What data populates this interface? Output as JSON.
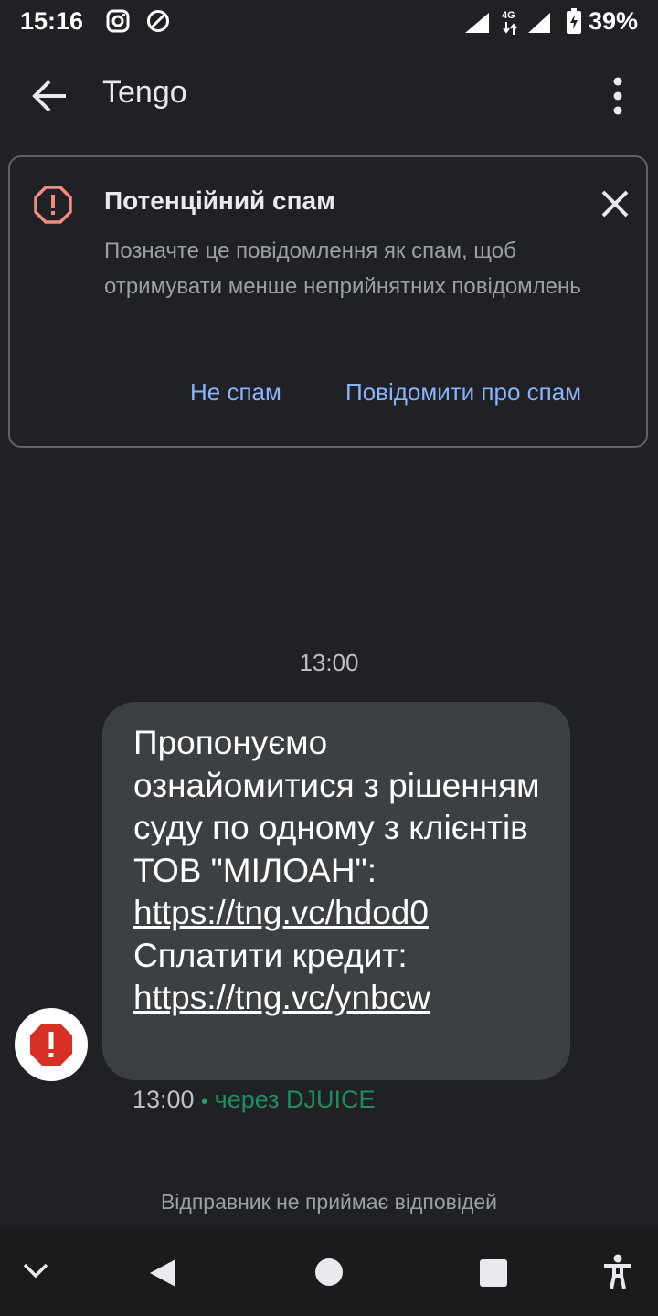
{
  "status_bar": {
    "time": "15:16",
    "network": "4G",
    "battery": "39%",
    "icons": [
      "instagram-icon",
      "do-not-disturb-icon",
      "signal-icon",
      "data-arrows-icon",
      "signal-icon",
      "battery-charging-icon"
    ]
  },
  "app_bar": {
    "title": "Tengo"
  },
  "spam_banner": {
    "title": "Потенційний спам",
    "body": "Позначте це повідомлення як спам, щоб отримувати менше неприйнятних повідомлень",
    "not_spam_label": "Не спам",
    "report_label": "Повідомити про спам",
    "accent_color": "#8ab4f8",
    "warning_color": "#f28b82"
  },
  "conversation": {
    "time_header": "13:00",
    "message": {
      "line1": "Пропонуємо ознайомитися з рішенням суду по одному з клієнтів ТОВ \"МІЛОАН\": ",
      "link1": "https://tng.vc/hdod0",
      "line2": " Сплатити кредит: ",
      "link2": "https://tng.vc/ynbcw"
    },
    "meta_time": "13:00",
    "meta_separator": "•",
    "meta_via": "через DJUICE",
    "error_color": "#d93025"
  },
  "footer": {
    "no_reply": "Відправник не приймає відповідей"
  },
  "nav_bar": {
    "items": [
      "chevron-down-icon",
      "back-triangle-icon",
      "home-circle-icon",
      "recents-square-icon",
      "accessibility-icon"
    ]
  }
}
